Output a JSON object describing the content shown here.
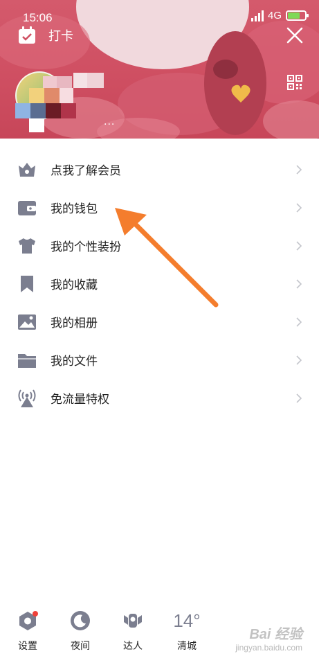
{
  "status_bar": {
    "time": "15:06",
    "network": "4G",
    "battery_level": 0.7
  },
  "header": {
    "checkin_label": "打卡",
    "more_dots": "..."
  },
  "menu": {
    "items": [
      {
        "label": "点我了解会员",
        "icon": "crown-icon"
      },
      {
        "label": "我的钱包",
        "icon": "wallet-icon"
      },
      {
        "label": "我的个性装扮",
        "icon": "shirt-icon"
      },
      {
        "label": "我的收藏",
        "icon": "bookmark-icon"
      },
      {
        "label": "我的相册",
        "icon": "photo-icon"
      },
      {
        "label": "我的文件",
        "icon": "folder-icon"
      },
      {
        "label": "免流量特权",
        "icon": "antenna-icon"
      }
    ]
  },
  "bottom_bar": {
    "settings_label": "设置",
    "night_label": "夜间",
    "expert_label": "达人",
    "weather_temp": "14°",
    "weather_city": "清城"
  },
  "watermark": {
    "logo": "Bai 经验",
    "url": "jingyan.baidu.com"
  },
  "colors": {
    "header_pink": "#cf4f62",
    "icon_gray": "#7b7e8f",
    "annotation_orange": "#f47d2d",
    "badge_red": "#f0413a"
  }
}
